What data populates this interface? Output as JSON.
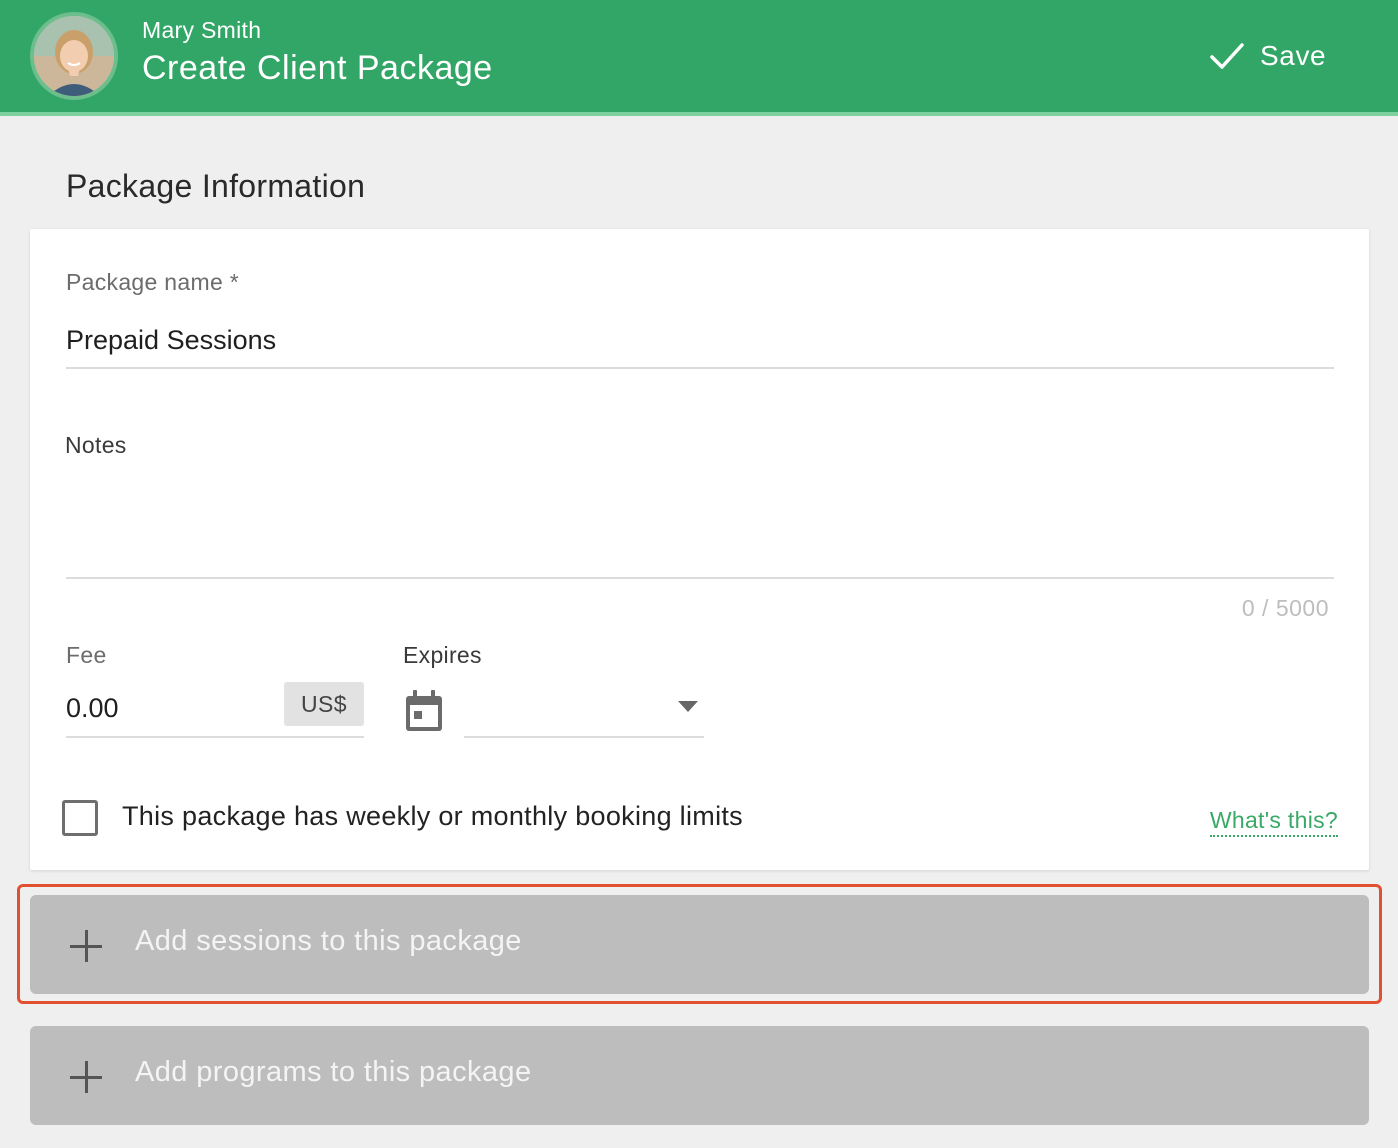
{
  "header": {
    "user_name": "Mary Smith",
    "title": "Create Client Package",
    "save_label": "Save",
    "avatar_icon": "user-avatar",
    "save_icon": "checkmark-icon",
    "bg_color": "#32a667"
  },
  "section": {
    "title": "Package Information"
  },
  "form": {
    "package_name_label": "Package name *",
    "package_name_value": "Prepaid Sessions",
    "notes_label": "Notes",
    "notes_value": "",
    "notes_counter": "0 / 5000",
    "fee_label": "Fee",
    "fee_value": "0.00",
    "currency": "US$",
    "expires_label": "Expires",
    "expires_value": "",
    "calendar_icon": "calendar-icon",
    "booking_limits_label": "This package has weekly or monthly booking limits",
    "booking_limits_checked": false,
    "whats_this_label": "What's this?"
  },
  "panels": {
    "add_sessions_label": "Add sessions to this package",
    "add_programs_label": "Add programs to this package",
    "highlight_color": "#e2512f"
  }
}
